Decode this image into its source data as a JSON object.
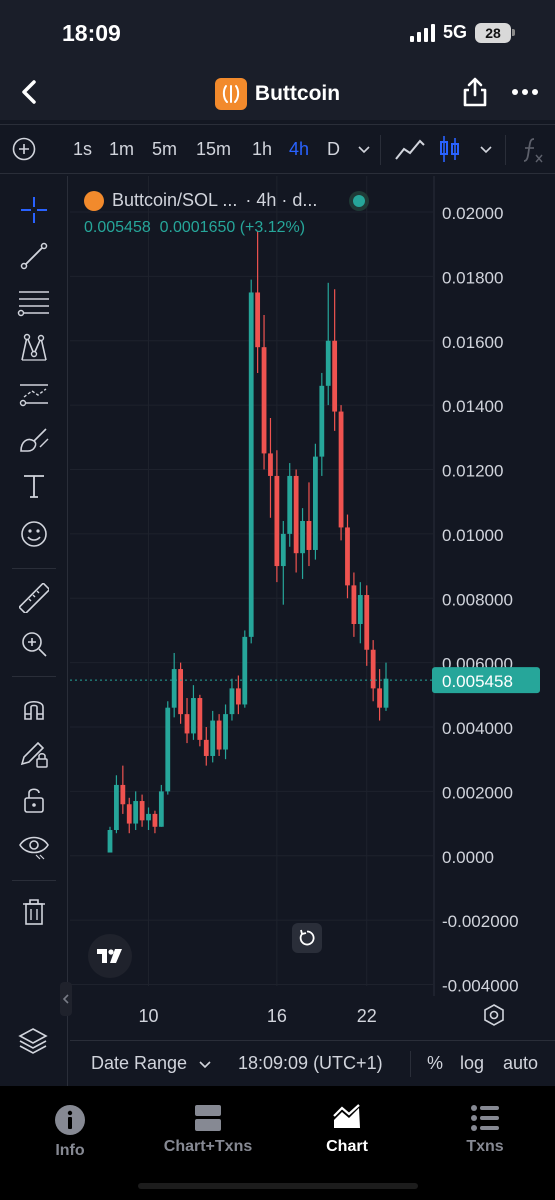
{
  "status": {
    "time": "18:09",
    "network": "5G",
    "battery": "28"
  },
  "header": {
    "title": "Buttcoin"
  },
  "toolbar": {
    "timeframes": [
      "1s",
      "1m",
      "5m",
      "15m",
      "1h",
      "4h",
      "D"
    ],
    "active_timeframe": "4h"
  },
  "legend": {
    "pair": "Buttcoin/SOL ...",
    "interval": "· 4h · d...",
    "price": "0.005458",
    "change": "0.0001650 (+3.12%)"
  },
  "colors": {
    "up": "#26a69a",
    "down": "#ef5350",
    "accent": "#2962ff",
    "bg": "#131722"
  },
  "chart_data": {
    "type": "candlestick",
    "title": "",
    "xlabel": "",
    "ylabel": "",
    "x_ticks": [
      "10",
      "16",
      "22"
    ],
    "y_ticks": [
      "0.02000",
      "0.01800",
      "0.01600",
      "0.01400",
      "0.01200",
      "0.01000",
      "0.008000",
      "0.006000",
      "0.004000",
      "0.002000",
      "0.0000",
      "-0.002000",
      "-0.004000"
    ],
    "ylim": [
      -0.004,
      0.02
    ],
    "last_price": "0.005458",
    "series": [
      {
        "values": [
          [
            0.0001,
            0.0009,
            0.0002,
            0.0008
          ],
          [
            0.0008,
            0.0025,
            0.0007,
            0.0022
          ],
          [
            0.0022,
            0.0028,
            0.0013,
            0.0016
          ],
          [
            0.0016,
            0.0018,
            0.0007,
            0.001
          ],
          [
            0.001,
            0.002,
            0.0008,
            0.0017
          ],
          [
            0.0017,
            0.0019,
            0.0009,
            0.0011
          ],
          [
            0.0011,
            0.0015,
            0.0008,
            0.0013
          ],
          [
            0.0013,
            0.0014,
            0.0007,
            0.0009
          ],
          [
            0.0009,
            0.0022,
            0.0009,
            0.002
          ],
          [
            0.002,
            0.0048,
            0.0019,
            0.0046
          ],
          [
            0.0046,
            0.0063,
            0.0043,
            0.0058
          ],
          [
            0.0058,
            0.006,
            0.0041,
            0.0044
          ],
          [
            0.0044,
            0.0049,
            0.0035,
            0.0038
          ],
          [
            0.0038,
            0.0053,
            0.0036,
            0.0049
          ],
          [
            0.0049,
            0.005,
            0.0034,
            0.0036
          ],
          [
            0.0036,
            0.004,
            0.0028,
            0.0031
          ],
          [
            0.0031,
            0.0045,
            0.0029,
            0.0042
          ],
          [
            0.0042,
            0.0044,
            0.0031,
            0.0033
          ],
          [
            0.0033,
            0.0047,
            0.003,
            0.0044
          ],
          [
            0.0044,
            0.0055,
            0.0042,
            0.0052
          ],
          [
            0.0052,
            0.0056,
            0.0044,
            0.0047
          ],
          [
            0.0047,
            0.007,
            0.0046,
            0.0068
          ],
          [
            0.0068,
            0.0179,
            0.0066,
            0.0175
          ],
          [
            0.0175,
            0.0194,
            0.015,
            0.0158
          ],
          [
            0.0158,
            0.0168,
            0.012,
            0.0125
          ],
          [
            0.0125,
            0.0136,
            0.0105,
            0.0118
          ],
          [
            0.0118,
            0.0126,
            0.0085,
            0.009
          ],
          [
            0.009,
            0.0104,
            0.0078,
            0.01
          ],
          [
            0.01,
            0.0122,
            0.0096,
            0.0118
          ],
          [
            0.0118,
            0.012,
            0.0088,
            0.0094
          ],
          [
            0.0094,
            0.0108,
            0.0086,
            0.0104
          ],
          [
            0.0104,
            0.0116,
            0.009,
            0.0095
          ],
          [
            0.0095,
            0.0128,
            0.0092,
            0.0124
          ],
          [
            0.0124,
            0.015,
            0.0118,
            0.0146
          ],
          [
            0.0146,
            0.0178,
            0.014,
            0.016
          ],
          [
            0.016,
            0.0176,
            0.0132,
            0.0138
          ],
          [
            0.0138,
            0.014,
            0.0098,
            0.0102
          ],
          [
            0.0102,
            0.0106,
            0.008,
            0.0084
          ],
          [
            0.0084,
            0.0088,
            0.0068,
            0.0072
          ],
          [
            0.0072,
            0.0085,
            0.0066,
            0.0081
          ],
          [
            0.0081,
            0.0084,
            0.0059,
            0.0064
          ],
          [
            0.0064,
            0.0067,
            0.0048,
            0.0052
          ],
          [
            0.0052,
            0.0058,
            0.0042,
            0.0046
          ],
          [
            0.0046,
            0.006,
            0.0045,
            0.0055
          ]
        ]
      }
    ]
  },
  "bottom_bar": {
    "date_range": "Date Range",
    "time": "18:09:09 (UTC+1)",
    "percent": "%",
    "log": "log",
    "auto": "auto"
  },
  "nav": [
    {
      "label": "Info",
      "icon": "info-icon"
    },
    {
      "label": "Chart+Txns",
      "icon": "split-view-icon"
    },
    {
      "label": "Chart",
      "icon": "area-chart-icon"
    },
    {
      "label": "Txns",
      "icon": "list-icon"
    }
  ]
}
